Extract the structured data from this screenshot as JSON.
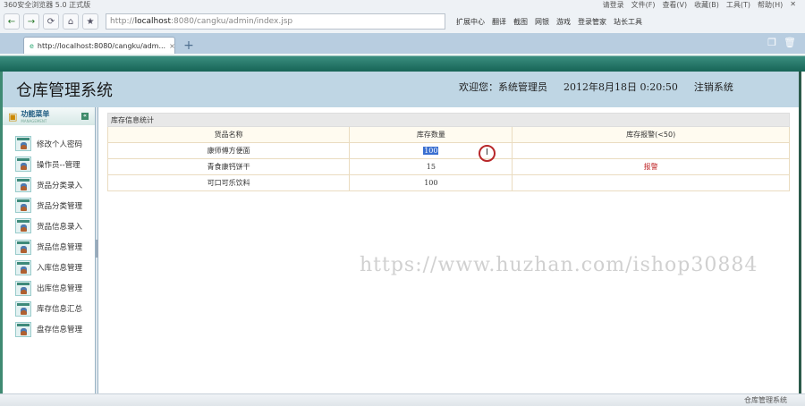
{
  "browser": {
    "title": "360安全浏览器 5.0 正式版",
    "menu": [
      "请登录",
      "文件(F)",
      "查看(V)",
      "收藏(B)",
      "工具(T)",
      "帮助(H)"
    ],
    "url_prefix": "http://",
    "url_host": "localhost",
    "url_rest": ":8080/cangku/admin/index.jsp",
    "toolbar": [
      "扩展中心",
      "翻译",
      "截图",
      "网银",
      "游戏",
      "登录管家",
      "站长工具"
    ],
    "tab_title": "http://localhost:8080/cangku/adm...",
    "status_text": "仓库管理系统"
  },
  "header": {
    "title": "仓库管理系统",
    "welcome": "欢迎您：系统管理员",
    "datetime": "2012年8月18日  0:20:50",
    "logout": "注销系统"
  },
  "sidebar": {
    "title": "功能菜单",
    "subtitle": "MANAGEMENT",
    "items": [
      "修改个人密码",
      "操作员--管理",
      "货品分类录入",
      "货品分类管理",
      "货品信息录入",
      "货品信息管理",
      "入库信息管理",
      "出库信息管理",
      "库存信息汇总",
      "盘存信息管理"
    ]
  },
  "table": {
    "title": "库存信息统计",
    "columns": [
      "货品名称",
      "库存数量",
      "库存报警(<50)"
    ],
    "rows": [
      {
        "name": "康师傅方便面",
        "qty": "100",
        "alarm": ""
      },
      {
        "name": "青食康钙饼干",
        "qty": "15",
        "alarm": "报警"
      },
      {
        "name": "可口可乐饮料",
        "qty": "100",
        "alarm": ""
      }
    ]
  },
  "watermark": "https://www.huzhan.com/ishop30884"
}
